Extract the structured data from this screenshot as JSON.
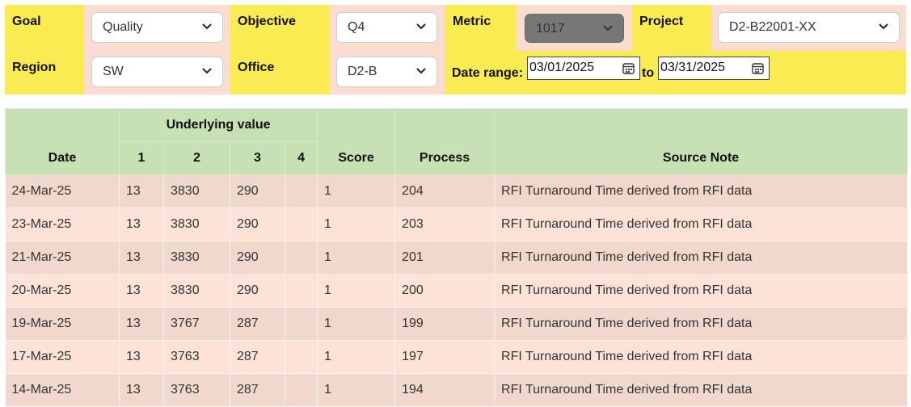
{
  "filters": {
    "goal": {
      "label": "Goal",
      "value": "Quality"
    },
    "objective": {
      "label": "Objective",
      "value": "Q4"
    },
    "metric": {
      "label": "Metric",
      "value": "1017"
    },
    "project": {
      "label": "Project",
      "value": "D2-B22001-XX"
    },
    "region": {
      "label": "Region",
      "value": "SW"
    },
    "office": {
      "label": "Office",
      "value": "D2-B"
    },
    "date_range": {
      "label": "Date range:",
      "from": "03/01/2025",
      "to_label": "to",
      "to": "03/31/2025"
    }
  },
  "table": {
    "headers": {
      "date": "Date",
      "underlying": "Underlying value",
      "sub": [
        "1",
        "2",
        "3",
        "4"
      ],
      "score": "Score",
      "process": "Process",
      "source_note": "Source Note"
    },
    "rows": [
      {
        "date": "24-Mar-25",
        "v1": "13",
        "v2": "3830",
        "v3": "290",
        "v4": "",
        "score": "1",
        "process": "204",
        "note": "RFI Turnaround Time derived from RFI data"
      },
      {
        "date": "23-Mar-25",
        "v1": "13",
        "v2": "3830",
        "v3": "290",
        "v4": "",
        "score": "1",
        "process": "203",
        "note": "RFI Turnaround Time derived from RFI data"
      },
      {
        "date": "21-Mar-25",
        "v1": "13",
        "v2": "3830",
        "v3": "290",
        "v4": "",
        "score": "1",
        "process": "201",
        "note": "RFI Turnaround Time derived from RFI data"
      },
      {
        "date": "20-Mar-25",
        "v1": "13",
        "v2": "3830",
        "v3": "290",
        "v4": "",
        "score": "1",
        "process": "200",
        "note": "RFI Turnaround Time derived from RFI data"
      },
      {
        "date": "19-Mar-25",
        "v1": "13",
        "v2": "3767",
        "v3": "287",
        "v4": "",
        "score": "1",
        "process": "199",
        "note": "RFI Turnaround Time derived from RFI data"
      },
      {
        "date": "17-Mar-25",
        "v1": "13",
        "v2": "3763",
        "v3": "287",
        "v4": "",
        "score": "1",
        "process": "197",
        "note": "RFI Turnaround Time derived from RFI data"
      },
      {
        "date": "14-Mar-25",
        "v1": "13",
        "v2": "3763",
        "v3": "287",
        "v4": "",
        "score": "1",
        "process": "194",
        "note": "RFI Turnaround Time derived from RFI data"
      }
    ]
  }
}
